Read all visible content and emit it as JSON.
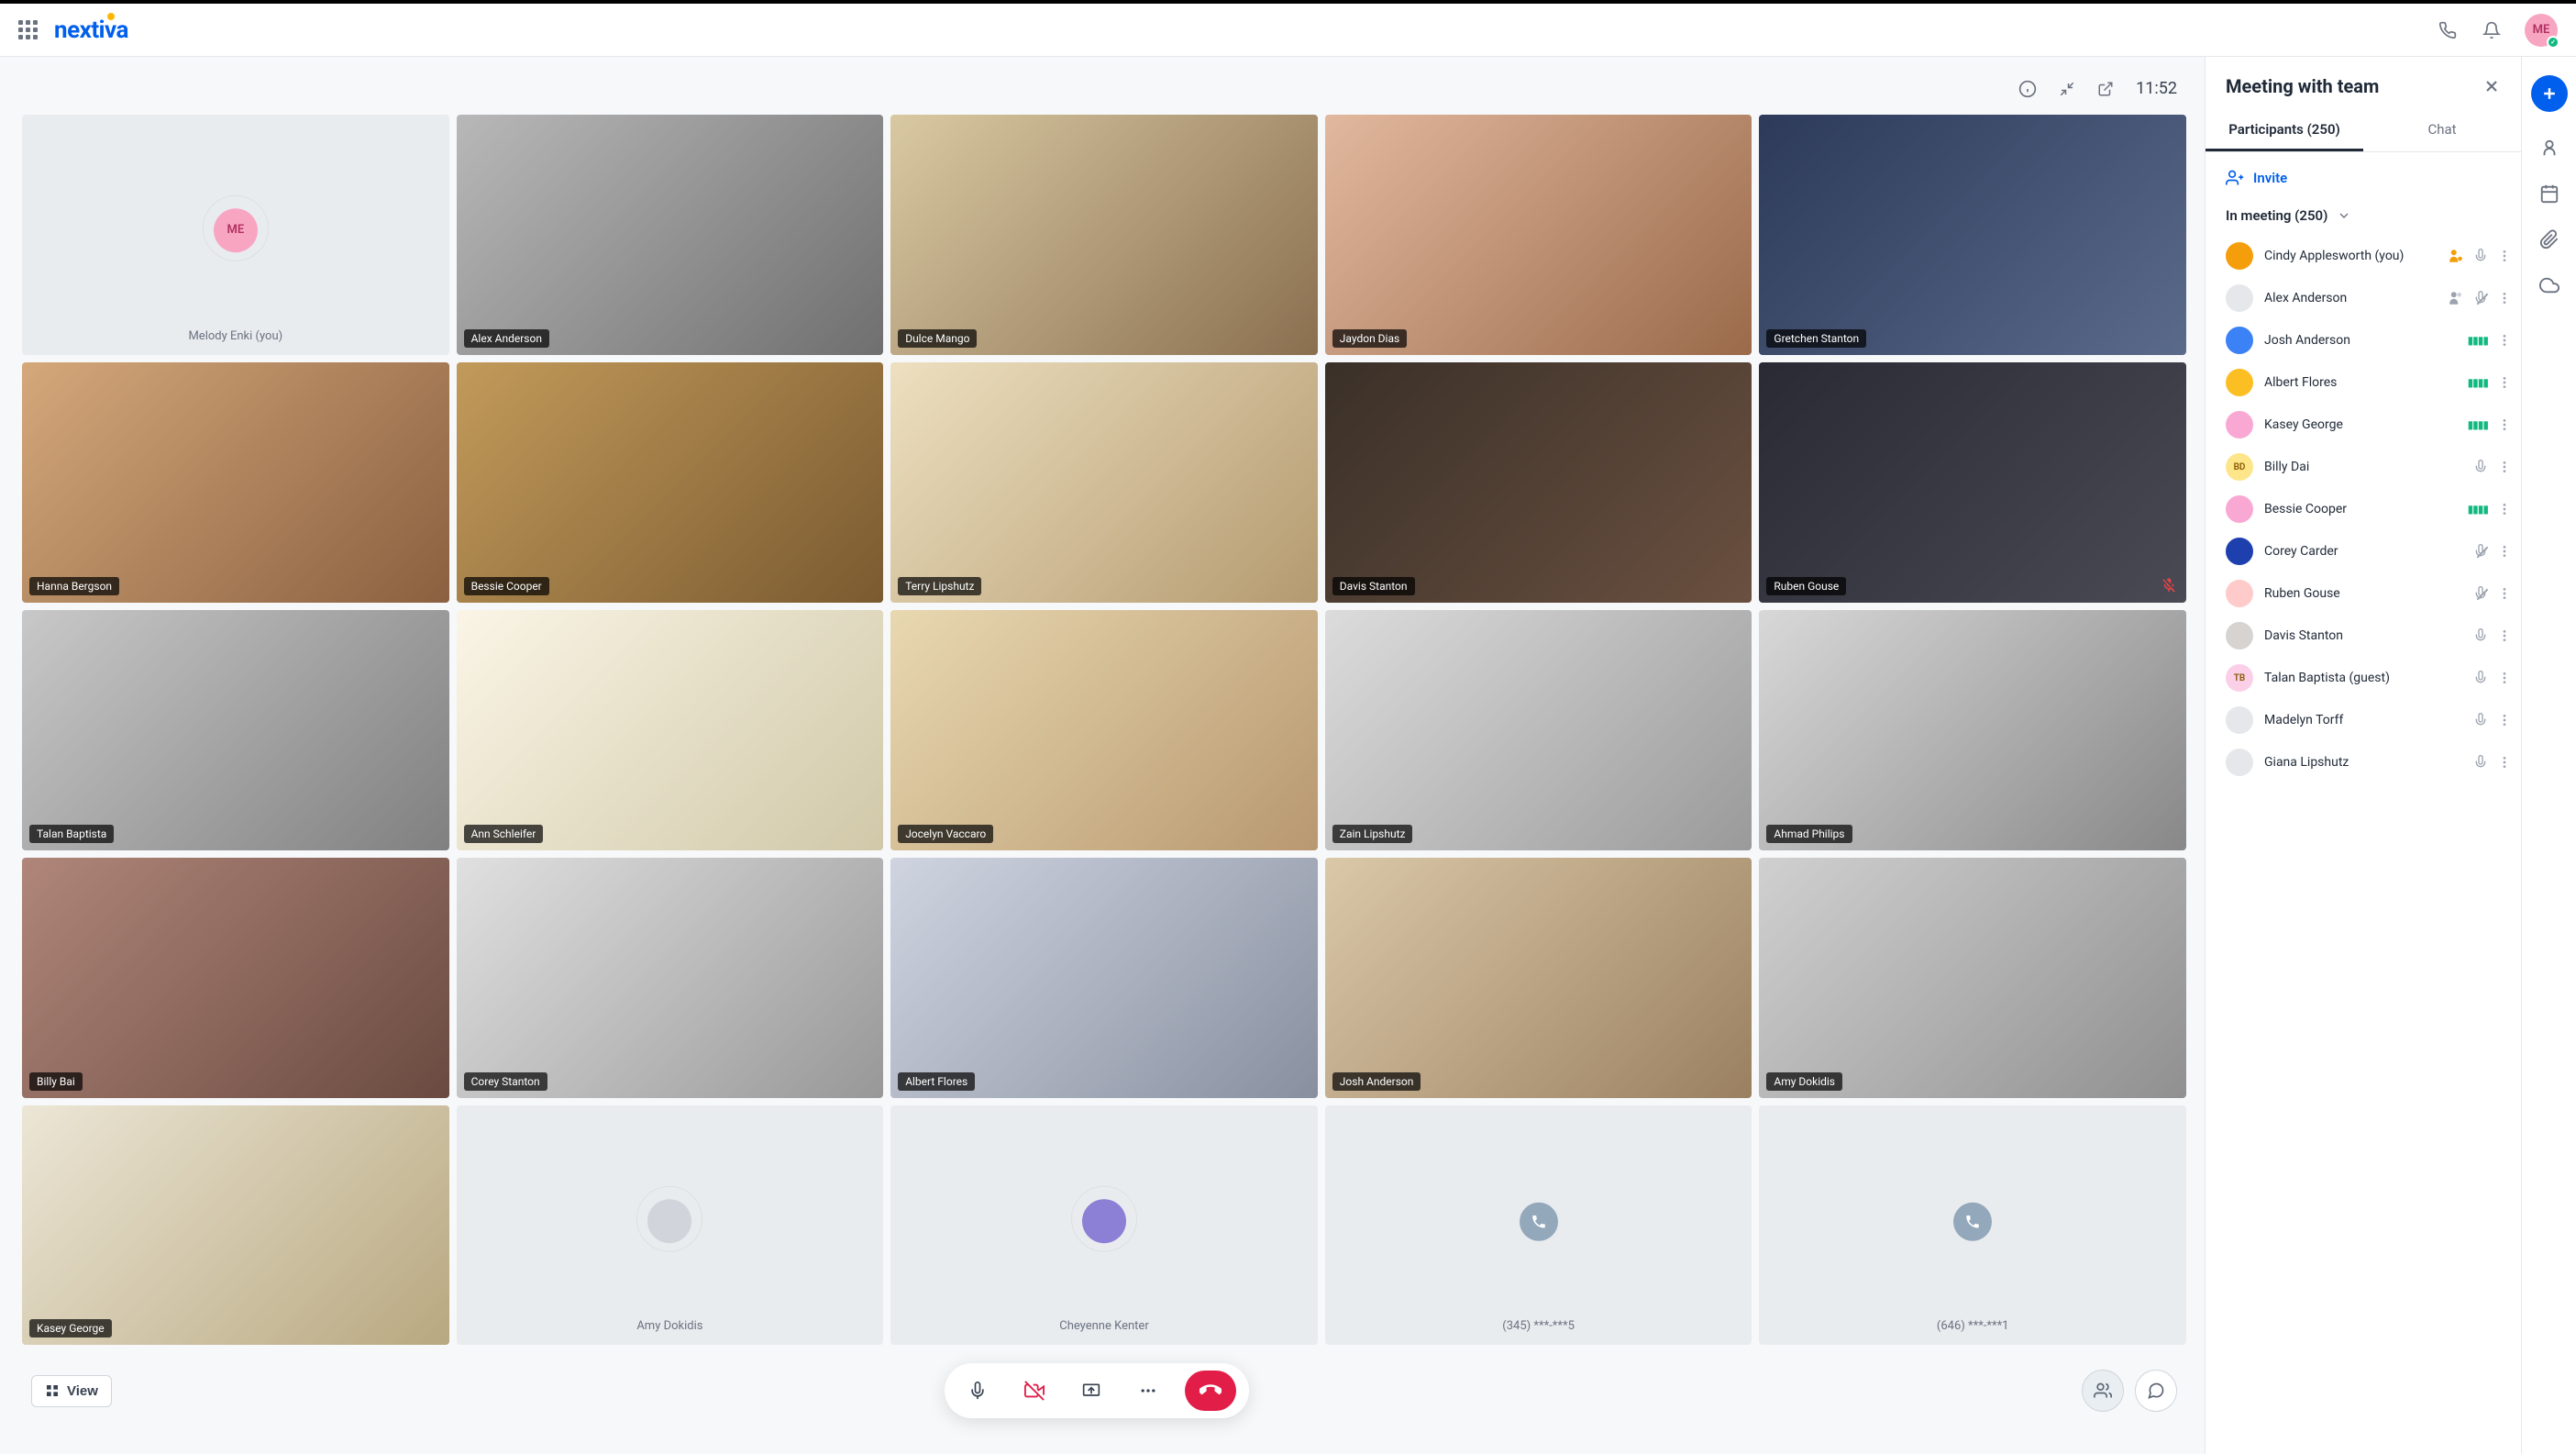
{
  "header": {
    "logo": "nextiva",
    "avatar_initials": "ME"
  },
  "video": {
    "time": "11:52",
    "tiles": [
      {
        "name": "Melody Enki (you)",
        "type": "me",
        "initials": "ME"
      },
      {
        "name": "Alex Anderson",
        "type": "video",
        "g": "g1"
      },
      {
        "name": "Dulce Mango",
        "type": "video",
        "g": "g2"
      },
      {
        "name": "Jaydon Dias",
        "type": "video",
        "g": "g3"
      },
      {
        "name": "Gretchen Stanton",
        "type": "video",
        "g": "g4"
      },
      {
        "name": "Hanna Bergson",
        "type": "video",
        "g": "g5"
      },
      {
        "name": "Bessie Cooper",
        "type": "video",
        "g": "g6"
      },
      {
        "name": "Terry Lipshutz",
        "type": "video",
        "g": "g7"
      },
      {
        "name": "Davis Stanton",
        "type": "video",
        "g": "g8"
      },
      {
        "name": "Ruben Gouse",
        "type": "video",
        "g": "g9",
        "muted": true
      },
      {
        "name": "Talan Baptista",
        "type": "video",
        "g": "g10"
      },
      {
        "name": "Ann Schleifer",
        "type": "video",
        "g": "g11"
      },
      {
        "name": "Jocelyn Vaccaro",
        "type": "video",
        "g": "g12"
      },
      {
        "name": "Zain Lipshutz",
        "type": "video",
        "g": "g13"
      },
      {
        "name": "Ahmad Philips",
        "type": "video",
        "g": "g14"
      },
      {
        "name": "Billy Bai",
        "type": "video",
        "g": "g15"
      },
      {
        "name": "Corey Stanton",
        "type": "video",
        "g": "g16"
      },
      {
        "name": "Albert Flores",
        "type": "video",
        "g": "g17"
      },
      {
        "name": "Josh Anderson",
        "type": "video",
        "g": "g18"
      },
      {
        "name": "Amy Dokidis",
        "type": "video",
        "g": "g19"
      },
      {
        "name": "Kasey George",
        "type": "video",
        "g": "g20"
      },
      {
        "name": "Amy Dokidis",
        "type": "avatar"
      },
      {
        "name": "Cheyenne Kenter",
        "type": "avatar",
        "av_bg": "#8b7fd6"
      },
      {
        "name": "(345) ***-***5",
        "type": "phone"
      },
      {
        "name": "(646) ***-***1",
        "type": "phone"
      }
    ]
  },
  "controls": {
    "view_label": "View"
  },
  "panel": {
    "title": "Meeting with team",
    "tab_participants": "Participants (250)",
    "tab_chat": "Chat",
    "invite_label": "Invite",
    "section_label": "In meeting (250)",
    "participants": [
      {
        "name": "Cindy Applesworth (you)",
        "avatar": "#f59e0b",
        "host": true,
        "mic": "on"
      },
      {
        "name": "Alex Anderson",
        "avatar": "#e5e7eb",
        "cohost": true,
        "mic": "muted"
      },
      {
        "name": "Josh Anderson",
        "avatar": "#3b82f6",
        "speaking": true
      },
      {
        "name": "Albert Flores",
        "avatar": "#fbbf24",
        "speaking": true
      },
      {
        "name": "Kasey George",
        "avatar": "#f9a8d4",
        "speaking": true
      },
      {
        "name": "Billy Dai",
        "avatar": "#fde68a",
        "initials": "BD",
        "mic": "on"
      },
      {
        "name": "Bessie Cooper",
        "avatar": "#f9a8d4",
        "speaking": true
      },
      {
        "name": "Corey Carder",
        "avatar": "#1e40af",
        "mic": "muted"
      },
      {
        "name": "Ruben Gouse",
        "avatar": "#fecaca",
        "mic": "muted"
      },
      {
        "name": "Davis Stanton",
        "avatar": "#d6d3d1",
        "mic": "on"
      },
      {
        "name": "Talan Baptista (guest)",
        "avatar": "#fbcfe8",
        "initials": "TB",
        "mic": "on"
      },
      {
        "name": "Madelyn Torff",
        "avatar": "#e5e7eb",
        "mic": "on"
      },
      {
        "name": "Giana Lipshutz",
        "avatar": "#e5e7eb",
        "mic": "on"
      }
    ]
  }
}
